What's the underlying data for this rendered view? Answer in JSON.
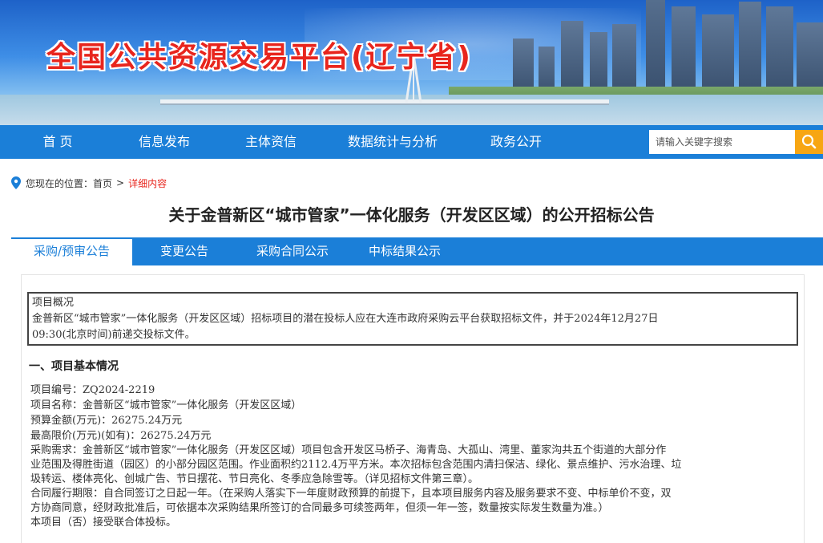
{
  "banner": {
    "title": "全国公共资源交易平台(辽宁省)"
  },
  "nav": {
    "items": [
      {
        "label": "首 页"
      },
      {
        "label": "信息发布"
      },
      {
        "label": "主体资信"
      },
      {
        "label": "数据统计与分析"
      },
      {
        "label": "政务公开"
      }
    ],
    "search": {
      "placeholder": "请输入关键字搜索",
      "icon": "search-icon"
    }
  },
  "breadcrumb": {
    "prefix": "您现在的位置：",
    "home": "首页",
    "separator": ">",
    "current": "详细内容",
    "icon": "location-pin-icon"
  },
  "page": {
    "title": "关于金普新区“城市管家”一体化服务（开发区区域）的公开招标公告"
  },
  "tabs": [
    {
      "label": "采购/预审公告",
      "active": true
    },
    {
      "label": "变更公告",
      "active": false
    },
    {
      "label": "采购合同公示",
      "active": false
    },
    {
      "label": "中标结果公示",
      "active": false
    }
  ],
  "overview": {
    "heading": "项目概况",
    "line1": "金普新区“城市管家”一体化服务（开发区区域）招标项目的潜在投标人应在大连市政府采购云平台获取招标文件，并于2024年12月27日",
    "line2": "09:30(北京时间)前递交投标文件。"
  },
  "section1": {
    "heading": "一、项目基本情况",
    "project_no": "项目编号：ZQ2024-2219",
    "project_name": "项目名称：金普新区“城市管家”一体化服务（开发区区域）",
    "budget": "预算金额(万元)：26275.24万元",
    "max_price": "最高限价(万元)(如有)：26275.24万元",
    "demand_line1": "采购需求：金普新区“城市管家”一体化服务（开发区区域）项目包含开发区马桥子、海青岛、大孤山、湾里、董家沟共五个街道的大部分作",
    "demand_line2": "业范围及得胜街道（园区）的小部分园区范围。作业面积约2112.4万平方米。本次招标包含范围内清扫保洁、绿化、景点维护、污水治理、垃",
    "demand_line3": "圾转运、楼体亮化、创城广告、节日摆花、节日亮化、冬季应急除雪等。（详见招标文件第三章）。",
    "term_line1": "合同履行期限：自合同签订之日起一年。（在采购人落实下一年度财政预算的前提下，且本项目服务内容及服务要求不变、中标单价不变，双",
    "term_line2": "方协商同意，经财政批准后，可依据本次采购结果所签订的合同最多可续签两年，但须一年一签，数量按实际发生数量为准。）",
    "consortium": "本项目（否）接受联合体投标。"
  }
}
